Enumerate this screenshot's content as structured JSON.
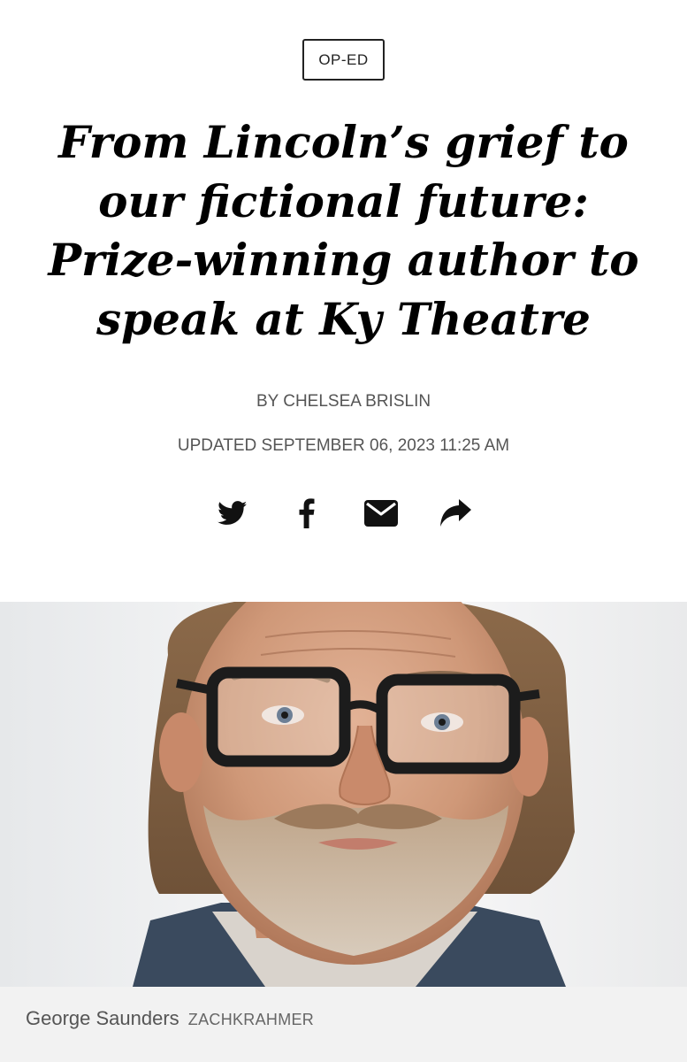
{
  "article": {
    "section_label": "OP-ED",
    "headline": "From Lincoln’s grief to our fictional future: Prize-winning author to speak at Ky Theatre",
    "byline": "BY CHELSEA BRISLIN",
    "updated": "UPDATED SEPTEMBER 06, 2023 11:25 AM"
  },
  "share": {
    "buttons": [
      {
        "icon": "twitter-icon"
      },
      {
        "icon": "facebook-icon"
      },
      {
        "icon": "email-icon"
      },
      {
        "icon": "share-arrow-icon"
      }
    ]
  },
  "photo": {
    "caption": "George Saunders",
    "credit": "ZACHKRAHMER"
  }
}
